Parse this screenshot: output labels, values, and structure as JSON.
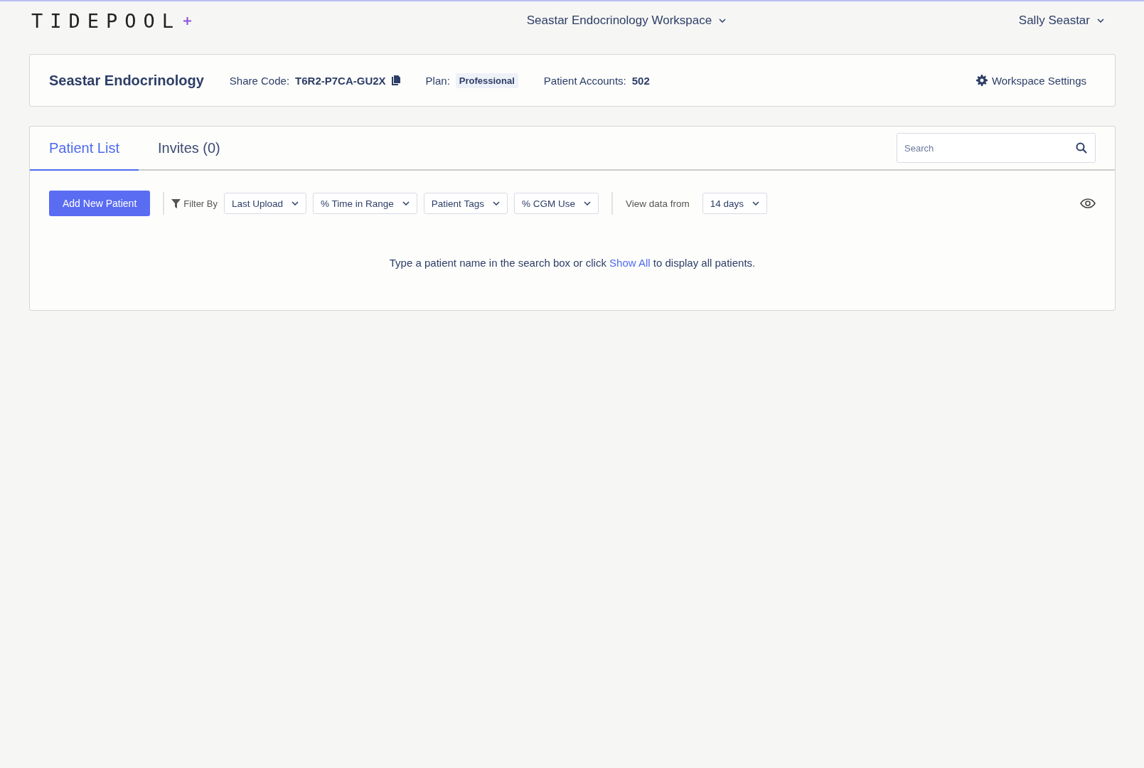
{
  "header": {
    "logo": "TIDEPOOL",
    "workspace_menu": "Seastar Endocrinology Workspace",
    "user_menu": "Sally Seastar"
  },
  "workspace": {
    "name": "Seastar Endocrinology",
    "share_code_label": "Share Code:",
    "share_code": "T6R2-P7CA-GU2X",
    "plan_label": "Plan:",
    "plan": "Professional",
    "accounts_label": "Patient Accounts:",
    "accounts": "502",
    "settings": "Workspace Settings"
  },
  "tabs": [
    {
      "label": "Patient List",
      "selected": true
    },
    {
      "label": "Invites (0)",
      "selected": false
    }
  ],
  "search": {
    "placeholder": "Search"
  },
  "toolbar": {
    "add_button": "Add New Patient",
    "filter_label": "Filter By",
    "filters": [
      {
        "label": "Last Upload"
      },
      {
        "label": "% Time in Range"
      },
      {
        "label": "Patient Tags"
      },
      {
        "label": "% CGM Use"
      }
    ],
    "view_label": "View data from",
    "view_value": "14 days"
  },
  "message": {
    "before": "Type a patient name in the search box or click ",
    "link": "Show All",
    "after": " to display all patients."
  }
}
